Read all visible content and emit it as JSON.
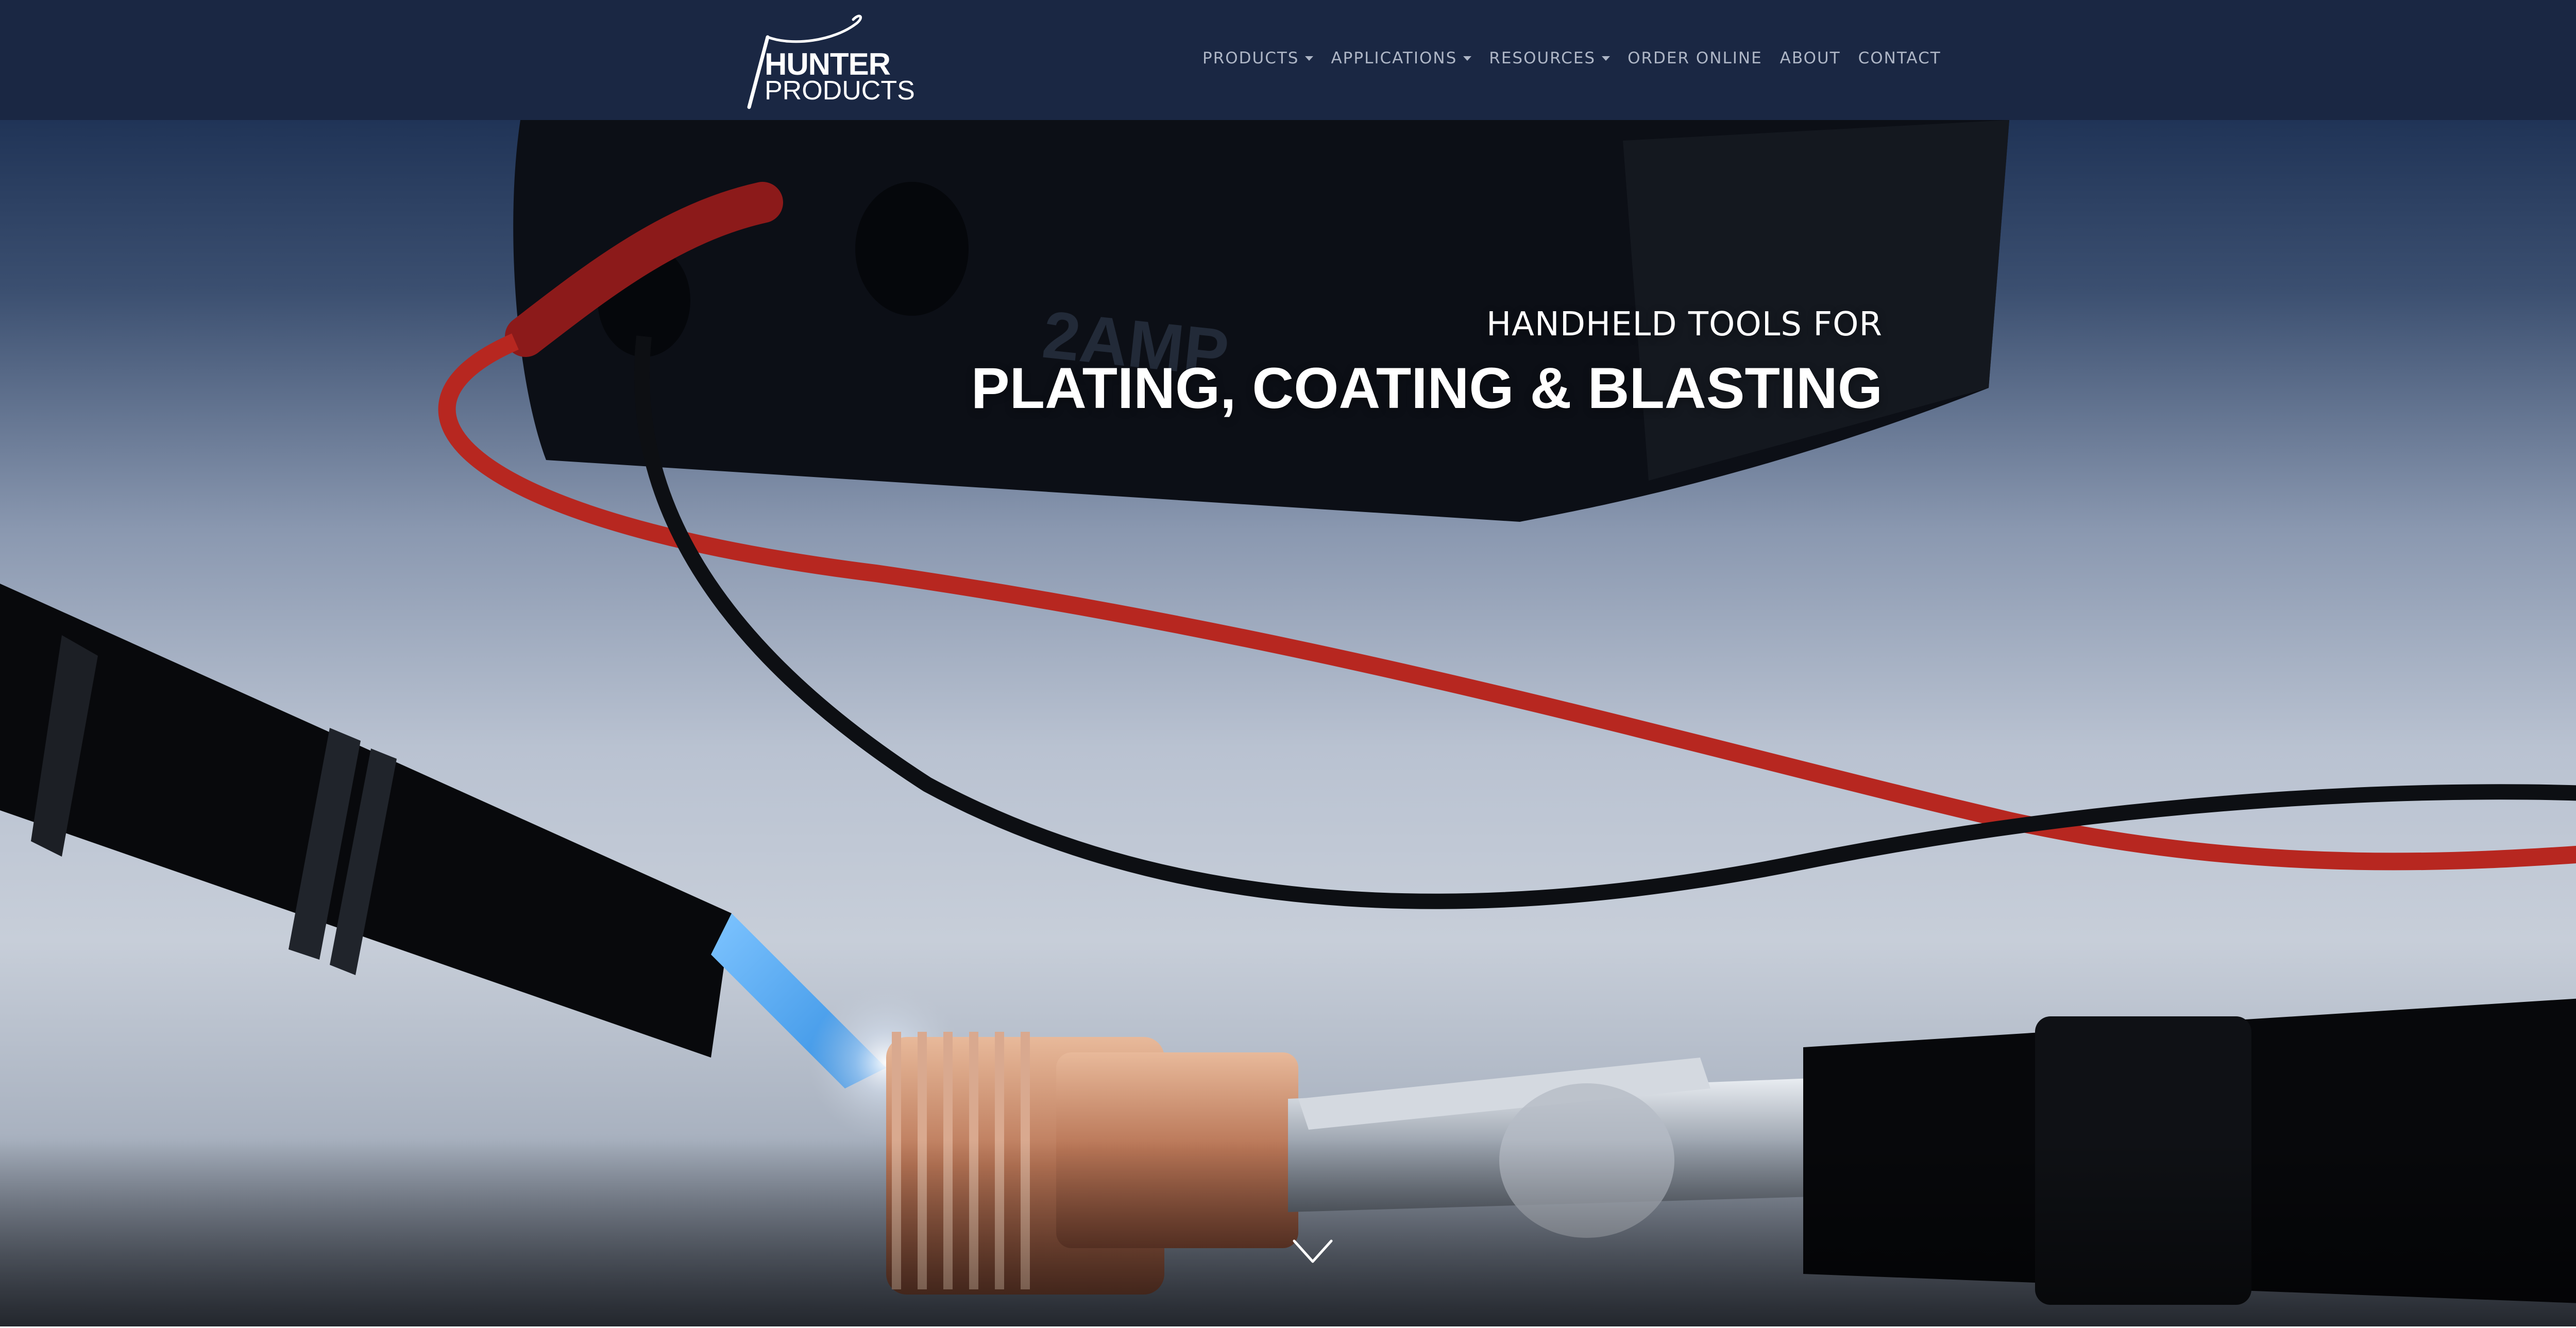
{
  "brand": {
    "line1": "HUNTER",
    "line2": "PRODUCTS",
    "color": "#ffffff"
  },
  "nav": {
    "items": [
      {
        "label": "PRODUCTS",
        "dropdown": true
      },
      {
        "label": "APPLICATIONS",
        "dropdown": true
      },
      {
        "label": "RESOURCES",
        "dropdown": true
      },
      {
        "label": "ORDER ONLINE",
        "dropdown": false
      },
      {
        "label": "ABOUT",
        "dropdown": false
      },
      {
        "label": "CONTACT",
        "dropdown": false
      }
    ],
    "background": "#1a2743",
    "text_color": "#aeb6c6"
  },
  "hero": {
    "subtitle": "HANDHELD TOOLS FOR",
    "title": "PLATING, COATING & BLASTING",
    "scroll_icon": "chevron-down-icon"
  }
}
